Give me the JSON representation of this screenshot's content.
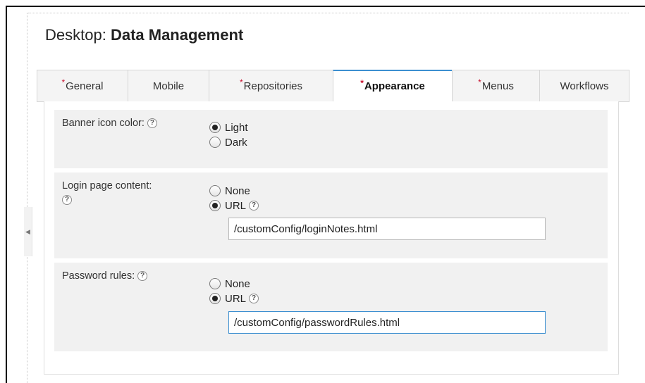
{
  "page": {
    "title_prefix": "Desktop:",
    "title_name": "Data Management"
  },
  "tabs": [
    {
      "label": "General",
      "required": true,
      "active": false
    },
    {
      "label": "Mobile",
      "required": false,
      "active": false
    },
    {
      "label": "Repositories",
      "required": true,
      "active": false
    },
    {
      "label": "Appearance",
      "required": true,
      "active": true
    },
    {
      "label": "Menus",
      "required": true,
      "active": false
    },
    {
      "label": "Workflows",
      "required": false,
      "active": false
    }
  ],
  "required_marker": "*",
  "help_glyph": "?",
  "collapse_glyph": "◀",
  "banner": {
    "label": "Banner icon color:",
    "options": [
      {
        "label": "Light",
        "checked": true
      },
      {
        "label": "Dark",
        "checked": false
      }
    ]
  },
  "login": {
    "label_line1": "Login page content:",
    "options": [
      {
        "label": "None",
        "checked": false
      },
      {
        "label": "URL",
        "checked": true
      }
    ],
    "url_value": "/customConfig/loginNotes.html"
  },
  "password": {
    "label": "Password rules:",
    "options": [
      {
        "label": "None",
        "checked": false
      },
      {
        "label": "URL",
        "checked": true
      }
    ],
    "url_value": "/customConfig/passwordRules.html"
  },
  "colors": {
    "active_tab_accent": "#3c8fd0",
    "required_marker": "#c8102e",
    "section_bg": "#f1f1f1"
  }
}
